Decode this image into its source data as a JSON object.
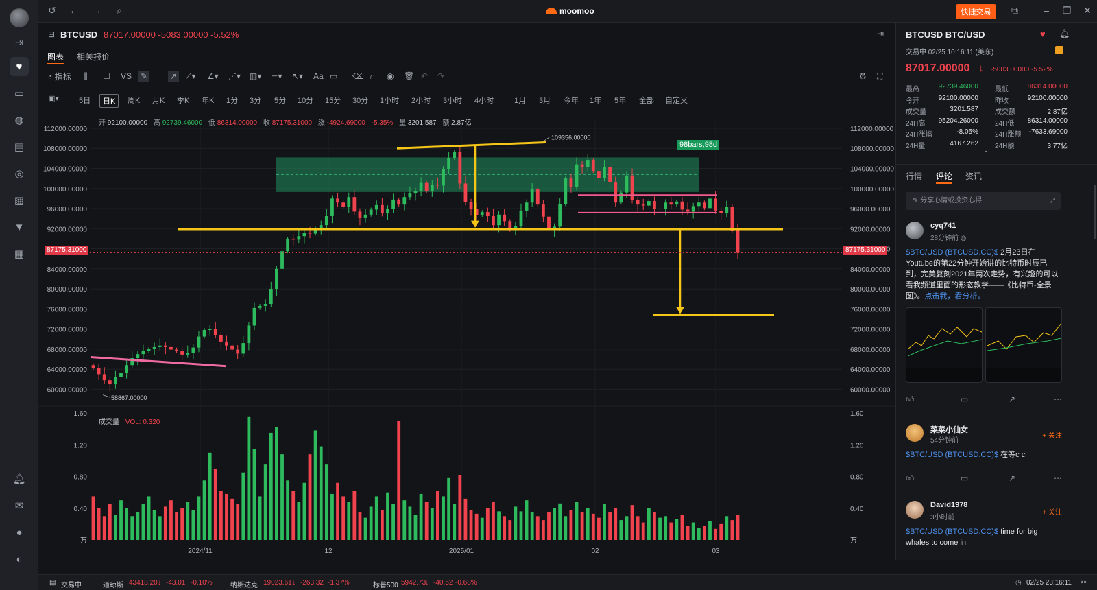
{
  "app": {
    "brand": "moomoo",
    "quick_trade": "快捷交易"
  },
  "header": {
    "symbol": "BTCUSD",
    "price_line": "87017.00000  -5083.00000  -5.52%"
  },
  "tabs": [
    "图表",
    "相关报价"
  ],
  "toolbar": {
    "indicator_label": "指标",
    "vs_label": "VS",
    "font_label": "Aa"
  },
  "periods": [
    "5日",
    "日K",
    "周K",
    "月K",
    "季K",
    "年K",
    "1分",
    "3分",
    "5分",
    "10分",
    "15分",
    "30分",
    "1小时",
    "2小时",
    "3小时",
    "4小时",
    "1月",
    "3月",
    "今年",
    "1年",
    "5年",
    "全部",
    "自定义"
  ],
  "ohlc": {
    "open_label": "开",
    "open": "92100.00000",
    "high_label": "高",
    "high": "92739.46000",
    "low_label": "低",
    "low": "86314.00000",
    "close_label": "收",
    "close": "87175.31000",
    "chg_label": "涨",
    "chg": "-4924.69000",
    "pct": "-5.35%",
    "vol_label": "量",
    "vol": "3201.587",
    "amt_label": "额",
    "amt": "2.87亿"
  },
  "volume_panel": {
    "label": "成交量",
    "value": "VOL: 0.320"
  },
  "chart_data": {
    "type": "candlestick",
    "y_axis_ticks": [
      "112000.00000",
      "108000.00000",
      "104000.00000",
      "100000.00000",
      "96000.00000",
      "92000.00000",
      "88000.00000",
      "84000.00000",
      "80000.00000",
      "76000.00000",
      "72000.00000",
      "68000.00000",
      "64000.00000",
      "60000.00000"
    ],
    "ylim": [
      58000,
      113500
    ],
    "x_axis_ticks": [
      "2024/11",
      "12",
      "2025/01",
      "02",
      "03"
    ],
    "volume_ticks": [
      "1.60",
      "1.20",
      "0.80",
      "0.40",
      "万"
    ],
    "volume_ylim": [
      0,
      1.6
    ],
    "annotations": {
      "high_marker": "109356.00000",
      "low_marker": "58867.00000",
      "last_price_tag": "87175.31000",
      "range_box_label": "98bars,98d"
    },
    "close_prices": [
      64200,
      63000,
      61800,
      61000,
      62500,
      63300,
      64800,
      66200,
      67000,
      67700,
      68000,
      68400,
      68700,
      68400,
      67900,
      67600,
      66900,
      67300,
      68300,
      70500,
      71800,
      72000,
      70800,
      69500,
      68700,
      67900,
      67100,
      69200,
      72700,
      76200,
      76600,
      77000,
      80000,
      84000,
      87500,
      90000,
      89800,
      90500,
      91200,
      91000,
      92000,
      92700,
      94500,
      98000,
      97200,
      96300,
      98300,
      95400,
      94100,
      94800,
      95800,
      96700,
      95100,
      96000,
      97800,
      96800,
      98300,
      99000,
      99500,
      101100,
      99500,
      100800,
      100600,
      103800,
      106100,
      107300,
      101000,
      97300,
      96000,
      94700,
      95300,
      94500,
      92700,
      94800,
      93500,
      91800,
      92500,
      95600,
      97200,
      99900,
      96800,
      94400,
      91800,
      92400,
      96900,
      102000,
      100300,
      104800,
      104300,
      105700,
      103500,
      102100,
      104300,
      101200,
      97200,
      99200,
      102600,
      97700,
      96800,
      96600,
      97500,
      95900,
      96000,
      97200,
      96800,
      97400,
      95800,
      95400,
      96500,
      97200,
      96100,
      98000,
      95600,
      95100,
      96400,
      91500,
      87175
    ],
    "volumes": [
      0.55,
      0.4,
      0.3,
      0.45,
      0.32,
      0.5,
      0.4,
      0.3,
      0.35,
      0.45,
      0.55,
      0.38,
      0.3,
      0.42,
      0.5,
      0.35,
      0.4,
      0.48,
      0.38,
      0.55,
      0.75,
      1.1,
      0.9,
      0.62,
      0.58,
      0.52,
      0.45,
      0.85,
      1.55,
      1.15,
      0.55,
      0.95,
      1.35,
      1.42,
      1.08,
      0.75,
      0.62,
      0.48,
      0.72,
      1.08,
      1.38,
      1.18,
      0.95,
      0.58,
      0.72,
      0.55,
      0.48,
      0.62,
      0.35,
      0.28,
      0.42,
      0.55,
      0.38,
      0.6,
      0.45,
      1.5,
      0.5,
      0.42,
      0.32,
      0.58,
      0.48,
      0.4,
      0.62,
      0.55,
      0.78,
      0.45,
      0.82,
      0.52,
      0.38,
      0.33,
      0.28,
      0.4,
      0.48,
      0.36,
      0.3,
      0.25,
      0.42,
      0.36,
      0.5,
      0.35,
      0.3,
      0.25,
      0.35,
      0.4,
      0.46,
      0.3,
      0.38,
      0.48,
      0.35,
      0.4,
      0.33,
      0.28,
      0.45,
      0.35,
      0.4,
      0.25,
      0.3,
      0.44,
      0.3,
      0.22,
      0.4,
      0.35,
      0.28,
      0.3,
      0.22,
      0.26,
      0.32,
      0.18,
      0.22,
      0.15,
      0.18,
      0.24,
      0.14,
      0.2,
      0.3,
      0.25,
      0.32
    ]
  },
  "right": {
    "title": "BTCUSD  BTC/USD",
    "status": "交易中 02/25 10:16:11 (美东)",
    "price": "87017.00000",
    "change": "-5083.00000  -5.52%",
    "stats": [
      {
        "l": "最高",
        "v": "92739.46000",
        "c": "g",
        "l2": "最低",
        "v2": "86314.00000",
        "c2": "r"
      },
      {
        "l": "今开",
        "v": "92100.00000",
        "c": "n",
        "l2": "昨收",
        "v2": "92100.00000",
        "c2": "n"
      },
      {
        "l": "成交量",
        "v": "3201.587",
        "c": "n",
        "l2": "成交额",
        "v2": "2.87亿",
        "c2": "n"
      },
      {
        "l": "24H高",
        "v": "95204.26000",
        "c": "n",
        "l2": "24H低",
        "v2": "86314.00000",
        "c2": "n"
      },
      {
        "l": "24H涨幅",
        "v": "-8.05%",
        "c": "n",
        "l2": "24H涨额",
        "v2": "-7633.69000",
        "c2": "n"
      },
      {
        "l": "24H量",
        "v": "4167.262",
        "c": "n",
        "l2": "24H额",
        "v2": "3.77亿",
        "c2": "n"
      }
    ],
    "tabs": [
      "行情",
      "评论",
      "资讯"
    ],
    "share_placeholder": "分享心情或投资心得",
    "posts": [
      {
        "name": "cyq741",
        "time": "28分钟前",
        "link": "$BTC/USD (BTCUSD.CC)$",
        "text": " 2月23日在Youtube的第22分钟开始讲的比特币时辰已到，完美复刻2021年两次走势，有兴趣的可以看我频道里面的形态教学——《比特币-全景图》。",
        "link2": "点击我，看分析。"
      },
      {
        "name": "菜菜小仙女",
        "time": "54分钟前",
        "link": "$BTC/USD (BTCUSD.CC)$",
        "text": " 在等c ci",
        "follow": "+ 关注"
      },
      {
        "name": "David1978",
        "time": "3小时前",
        "link": "$BTC/USD (BTCUSD.CC)$",
        "text": " time for big whales to come in",
        "follow": "+ 关注"
      }
    ]
  },
  "statusbar": {
    "market": "交易中",
    "dow": {
      "name": "道琼斯",
      "val": "43418.20",
      "chg": "-43.01",
      "pct": "-0.10%"
    },
    "nasdaq": {
      "name": "纳斯达克",
      "val": "19023.61",
      "chg": "-263.32",
      "pct": "-1.37%"
    },
    "sp": {
      "name": "标普500",
      "val": "5942.73",
      "chg": "-40.52",
      "pct": "-0.68%"
    },
    "time": "02/25 23:16:11"
  },
  "colors": {
    "up": "#2dbb5e",
    "down": "#f0434e",
    "accent": "#ff6a13",
    "annotation": "#f5c518",
    "range_box": "#1f8f5f"
  }
}
